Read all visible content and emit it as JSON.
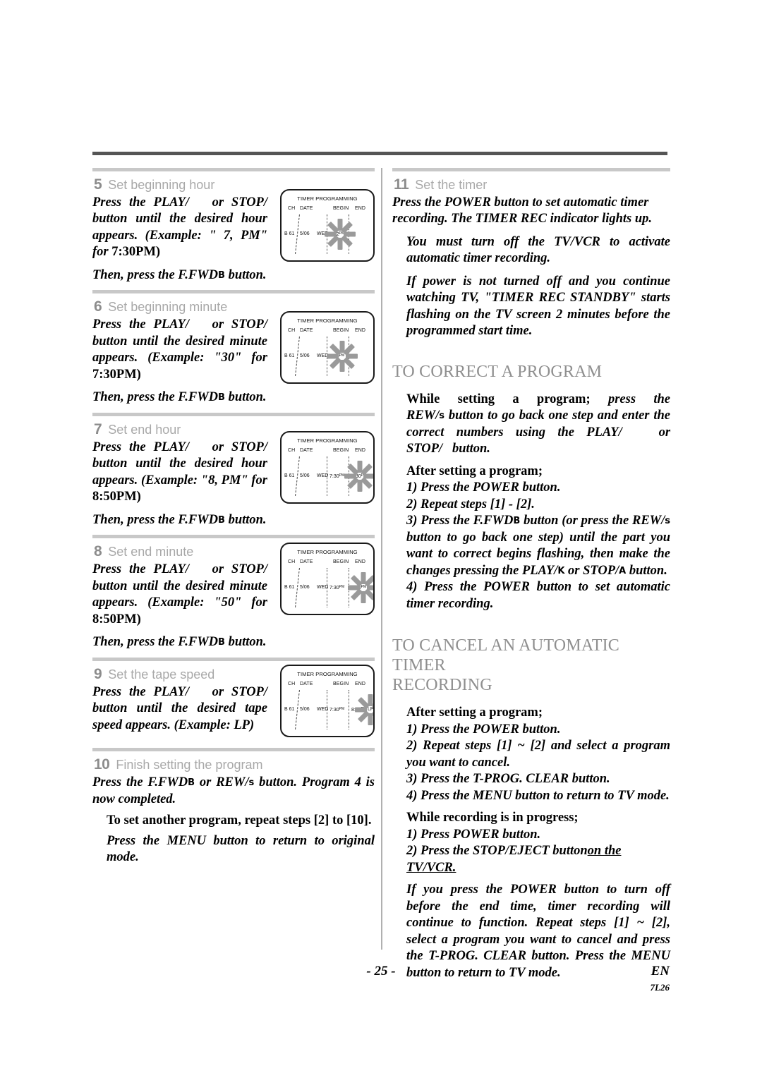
{
  "page": {
    "number_label": "- 25 -",
    "language_code": "EN",
    "doc_code": "7L26"
  },
  "left_column": {
    "steps": [
      {
        "number": "5",
        "title": "Set beginning hour",
        "para1": "Press the PLAY/",
        "para1b": "or STOP/",
        "para1c": "button until the desired hour appears.  (Example: \" 7, PM\" for",
        "para1d": "7:30",
        "para1e": "PM)",
        "para2_pre": "Then, press the F.FWD",
        "para2_sym": "B",
        "para2_post": "button.",
        "screen": {
          "title": "TIMER PROGRAMMING",
          "headers": {
            "ch": "CH",
            "date": "DATE",
            "begin": "BEGIN",
            "end": "END"
          },
          "values": {
            "ch": "B 61",
            "date": "5/06",
            "day": "WED",
            "begin": "7:12",
            "begin_ampm": "PM",
            "end": "",
            "speed": ""
          },
          "flash_target": "begin-hour"
        }
      },
      {
        "number": "6",
        "title": "Set beginning minute",
        "para1": "Press the PLAY/",
        "para1b": "or STOP/",
        "para1c": "button until the desired minute appears.  (Example: \"30\" for",
        "para1d": "7:30",
        "para1e": "PM)",
        "para2_pre": "Then, press the F.FWD",
        "para2_sym": "B",
        "para2_post": "button.",
        "screen": {
          "title": "TIMER PROGRAMMING",
          "headers": {
            "ch": "CH",
            "date": "DATE",
            "begin": "BEGIN",
            "end": "END"
          },
          "values": {
            "ch": "B 61",
            "date": "5/06",
            "day": "WED",
            "begin": "7:30",
            "begin_ampm": "PM",
            "end": "",
            "speed": ""
          },
          "flash_target": "begin-minute"
        }
      },
      {
        "number": "7",
        "title": "Set end hour",
        "para1": "Press the PLAY/",
        "para1b": "or STOP/",
        "para1c": "button until the desired hour appears.  (Example: \"8, PM\" for",
        "para1d": "8:50",
        "para1e": "PM)",
        "para2_pre": "Then, press the F.FWD",
        "para2_sym": "B",
        "para2_post": "button.",
        "screen": {
          "title": "TIMER PROGRAMMING",
          "headers": {
            "ch": "CH",
            "date": "DATE",
            "begin": "BEGIN",
            "end": "END"
          },
          "values": {
            "ch": "B 61",
            "date": "5/06",
            "day": "WED",
            "begin": "7:30",
            "begin_ampm": "PM",
            "end": "8:30",
            "end_ampm": "PM",
            "speed": ""
          },
          "flash_target": "end-hour"
        }
      },
      {
        "number": "8",
        "title": "Set end minute",
        "para1": "Press the PLAY/",
        "para1b": "or STOP/",
        "para1c": "button until the desired minute appears.  (Example: \"50\" for",
        "para1d": "8:50",
        "para1e": "PM)",
        "para2_pre": "Then, press the F.FWD",
        "para2_sym": "B",
        "para2_post": "button.",
        "screen": {
          "title": "TIMER PROGRAMMING",
          "headers": {
            "ch": "CH",
            "date": "DATE",
            "begin": "BEGIN",
            "end": "END"
          },
          "values": {
            "ch": "B 61",
            "date": "5/06",
            "day": "WED",
            "begin": "7:30",
            "begin_ampm": "PM",
            "end": "8:50",
            "end_ampm": "PM",
            "speed": ""
          },
          "flash_target": "end-minute"
        }
      },
      {
        "number": "9",
        "title": "Set the tape speed",
        "para1": "Press the PLAY/",
        "para1b": "or STOP/",
        "para1c": "button until the desired tape speed appears. (Example: LP)",
        "screen": {
          "title": "TIMER PROGRAMMING",
          "headers": {
            "ch": "CH",
            "date": "DATE",
            "begin": "BEGIN",
            "end": "END"
          },
          "values": {
            "ch": "B 61",
            "date": "5/06",
            "day": "WED",
            "begin": "7:30",
            "begin_ampm": "PM",
            "end": "8:50",
            "end_ampm": "PM",
            "speed": "LP"
          },
          "flash_target": "tape-speed"
        }
      },
      {
        "number": "10",
        "title": "Finish setting the program",
        "final_pre": "Press the F.FWD",
        "final_sym1": "B",
        "final_mid": "or REW/",
        "final_sym2": "s",
        "final_post": "button. Program 4 is now completed.",
        "note1": "To set another program, repeat steps [2] to [10].",
        "note2": "Press the MENU button to return to original mode."
      }
    ]
  },
  "right_column": {
    "step11": {
      "number": "11",
      "title": "Set the timer",
      "para1": "Press the POWER button to set automatic timer recording. The TIMER REC indicator lights up.",
      "para2": "You must turn off the TV/VCR to activate automatic timer recording.",
      "para3": "If power is not turned off and you continue watching TV, \"TIMER REC STANDBY\" starts flashing on the TV screen 2 minutes before the programmed start time."
    },
    "correct_section": {
      "heading": "TO CORRECT A PROGRAM",
      "lead_bold": "While setting a program;",
      "lead_rest_a": "press the REW/",
      "lead_sym": "s",
      "lead_rest_b": "button to go back one step and enter the correct numbers using the PLAY/",
      "lead_rest_c": "or STOP/",
      "lead_rest_d": "button.",
      "after_label": "After setting a program;",
      "items": [
        {
          "num": "1)",
          "text": "Press the POWER button."
        },
        {
          "num": "2)",
          "text": "Repeat steps [1] - [2]."
        },
        {
          "num": "3)",
          "text_pre": "Press the F.FWD",
          "sym1": "B",
          "text_mid": "button (or press the REW/",
          "sym2": "s",
          "text_post": "button to go back one step) until the part you want to correct begins flashing, then make the changes pressing the PLAY/",
          "sym3": "K",
          "text_post2": "or STOP/",
          "sym4": "A",
          "text_post3": "button."
        },
        {
          "num": "4)",
          "text": "Press the POWER button to set automatic timer recording."
        }
      ]
    },
    "cancel_section": {
      "heading_line1": "TO CANCEL AN AUTOMATIC TIMER",
      "heading_line2": "RECORDING",
      "after_label": "After setting a program;",
      "items": [
        {
          "num": "1)",
          "text": "Press the POWER button."
        },
        {
          "num": "2)",
          "text": "Repeat steps [1] ~ [2] and select a program you want to cancel."
        },
        {
          "num": "3)",
          "text": "Press the T-PROG. CLEAR button."
        },
        {
          "num": "4)",
          "text": "Press the MENU button to return to TV mode."
        }
      ],
      "during_label": "While recording is in progress;",
      "during_items": [
        {
          "num": "1)",
          "text": "Press POWER button."
        },
        {
          "num": "2)",
          "text_pre": "Press the STOP/EJECT button",
          "text_underline": "on the TV/VCR."
        }
      ],
      "closing": "If you press the POWER button to turn off before the end time, timer recording will continue to function. Repeat steps [1] ~ [2], select a program you want to cancel and press the T-PROG. CLEAR button. Press the MENU button to return to TV mode."
    }
  }
}
